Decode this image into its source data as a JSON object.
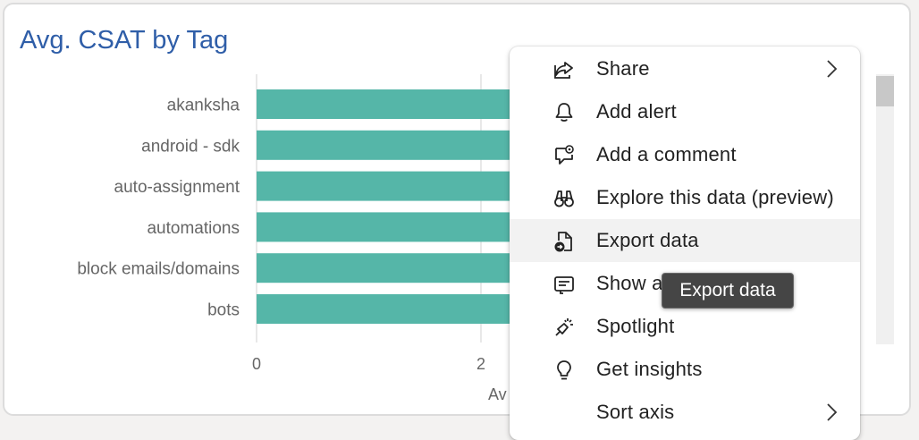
{
  "visual": {
    "title": "Avg. CSAT by Tag",
    "accent_color": "#2f5ea8"
  },
  "chart_data": {
    "type": "bar",
    "orientation": "horizontal",
    "categories": [
      "akanksha",
      "android - sdk",
      "auto-assignment",
      "automations",
      "block emails/domains",
      "bots"
    ],
    "x_tick_labels": [
      "0",
      "2"
    ],
    "xlabel_visible_fragment": "Av",
    "bar_color": "#55b6a8",
    "xlim": [
      0,
      2.5
    ],
    "note_values_hidden_behind_menu": true
  },
  "context_menu": {
    "items": [
      {
        "label": "Share",
        "icon": "share-icon",
        "submenu": true
      },
      {
        "label": "Add alert",
        "icon": "bell-icon",
        "submenu": false
      },
      {
        "label": "Add a comment",
        "icon": "comment-icon",
        "submenu": false
      },
      {
        "label": "Explore this data (preview)",
        "icon": "binoculars-icon",
        "submenu": false
      },
      {
        "label": "Export data",
        "icon": "export-icon",
        "submenu": false,
        "hovered": true
      },
      {
        "label": "Show a",
        "icon": "table-icon",
        "submenu": false
      },
      {
        "label": "Spotlight",
        "icon": "spotlight-icon",
        "submenu": false
      },
      {
        "label": "Get insights",
        "icon": "lightbulb-icon",
        "submenu": false
      },
      {
        "label": "Sort axis",
        "icon": "",
        "submenu": true
      }
    ]
  },
  "tooltip": {
    "text": "Export data"
  }
}
